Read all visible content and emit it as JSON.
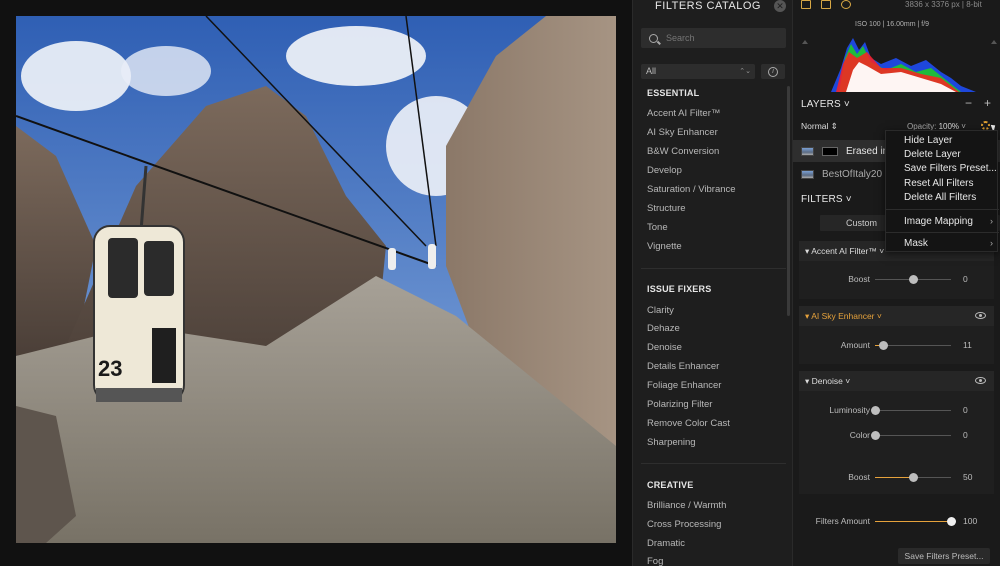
{
  "catalog": {
    "title": "FILTERS CATALOG",
    "search_placeholder": "Search",
    "category_selected": "All",
    "sections": [
      {
        "title": "ESSENTIAL",
        "items": [
          "Accent AI Filter™",
          "AI Sky Enhancer",
          "B&W Conversion",
          "Develop",
          "Saturation / Vibrance",
          "Structure",
          "Tone",
          "Vignette"
        ]
      },
      {
        "title": "ISSUE FIXERS",
        "items": [
          "Clarity",
          "Dehaze",
          "Denoise",
          "Details Enhancer",
          "Foliage Enhancer",
          "Polarizing Filter",
          "Remove Color Cast",
          "Sharpening"
        ]
      },
      {
        "title": "CREATIVE",
        "items": [
          "Brilliance / Warmth",
          "Cross Processing",
          "Dramatic",
          "Fog"
        ]
      }
    ]
  },
  "image_info": "3836 x 3376 px  |  8-bit",
  "exif": "ISO 100  |  16.00mm  |  f/9",
  "photo": {
    "cabin_number": "23"
  },
  "layers": {
    "title": "LAYERS",
    "blend_mode": "Normal",
    "opacity_label": "Opacity:",
    "opacity_value": "100%",
    "items": [
      {
        "name": "Erased ima",
        "selected": true
      },
      {
        "name": "BestOfItaly20",
        "selected": false
      }
    ]
  },
  "filters": {
    "title": "FILTERS",
    "custom_label": "Custom",
    "list": [
      {
        "name": "Accent AI Filter™",
        "highlight": false,
        "sliders": [
          {
            "label": "Boost",
            "value": 0,
            "min": -100,
            "max": 100
          }
        ]
      },
      {
        "name": "AI Sky Enhancer",
        "highlight": true,
        "sliders": [
          {
            "label": "Amount",
            "value": 11,
            "min": 0,
            "max": 100
          }
        ]
      },
      {
        "name": "Denoise",
        "highlight": false,
        "sliders": [
          {
            "label": "Luminosity",
            "value": 0,
            "min": 0,
            "max": 100
          },
          {
            "label": "Color",
            "value": 0,
            "min": 0,
            "max": 100
          },
          {
            "label": "Boost",
            "value": 50,
            "min": 0,
            "max": 100
          }
        ]
      }
    ],
    "filters_amount_label": "Filters Amount",
    "filters_amount_value": 100,
    "save_preset_label": "Save Filters Preset..."
  },
  "context_menu": {
    "items": [
      "Hide Layer",
      "Delete Layer",
      "Save Filters Preset...",
      "Reset All Filters",
      "Delete All Filters"
    ],
    "submenus": [
      "Image Mapping",
      "Mask"
    ]
  },
  "colors": {
    "accent": "#e6a23c",
    "panel_bg": "#1a1a1a",
    "catalog_bg": "#1e1e1e",
    "menu_bg": "#141414"
  }
}
